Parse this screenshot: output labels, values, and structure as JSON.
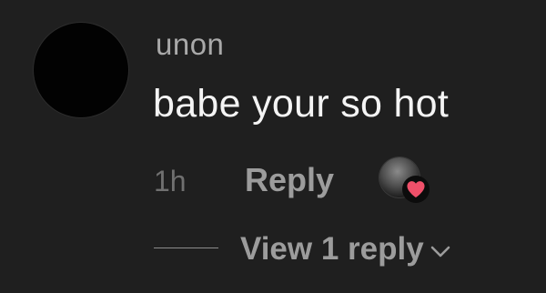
{
  "comment": {
    "username": "unon",
    "text": "babe your so hot",
    "time": "1h",
    "reply_label": "Reply",
    "view_replies_label": "View 1 reply"
  },
  "icons": {
    "avatar": "avatar",
    "liker_avatar": "liker-avatar",
    "heart": "heart-icon",
    "chevron": "chevron-down-icon"
  },
  "colors": {
    "background": "#1f1f1f",
    "heart": "#f0506a",
    "text": "#f4f4f4",
    "muted": "#9c9c9c"
  }
}
